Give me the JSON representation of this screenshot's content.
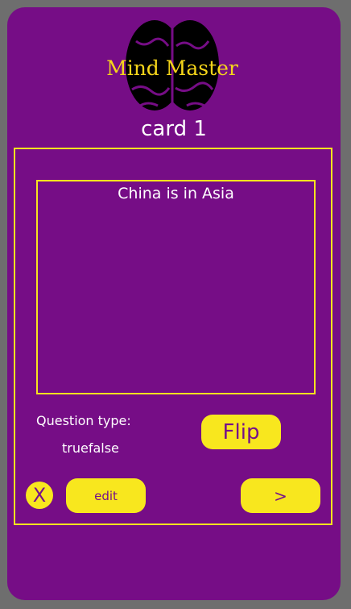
{
  "logo": {
    "title": "Mind Master",
    "icon": "brain-icon"
  },
  "card": {
    "title": "card  1",
    "question": "China is in Asia"
  },
  "question_type": {
    "label": "Question type:",
    "value": "truefalse"
  },
  "buttons": {
    "flip": "Flip",
    "delete": "X",
    "edit": "edit",
    "next": ">"
  },
  "colors": {
    "background": "#760d86",
    "accent": "#f8e71e",
    "frame": "#6e6e6e"
  }
}
